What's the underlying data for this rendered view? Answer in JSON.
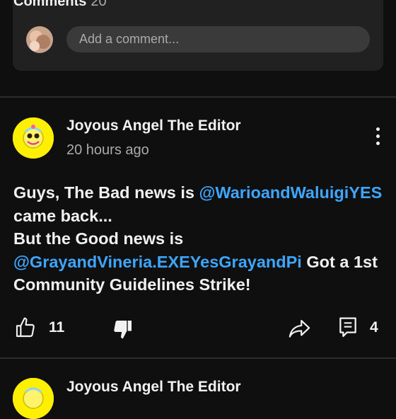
{
  "comments": {
    "title": "Comments",
    "count": "20",
    "placeholder": "Add a comment..."
  },
  "post": {
    "author": "Joyous Angel The Editor",
    "time": "20 hours ago",
    "text": {
      "p1": "Guys, The Bad news is ",
      "mention1": "@WarioandWaluigiYES",
      "p2": " came back...",
      "p3": "But the Good news is ",
      "mention2": "@GrayandVineria.EXEYesGrayandPi",
      "p4": " Got a 1st Community Guidelines Strike!"
    },
    "likes": "11",
    "comments": "4"
  },
  "next_post": {
    "author": "Joyous Angel The Editor"
  },
  "colors": {
    "background": "#0f0f0f",
    "card": "#212121",
    "mention": "#3ea6ff",
    "avatar": "#ffef00"
  }
}
